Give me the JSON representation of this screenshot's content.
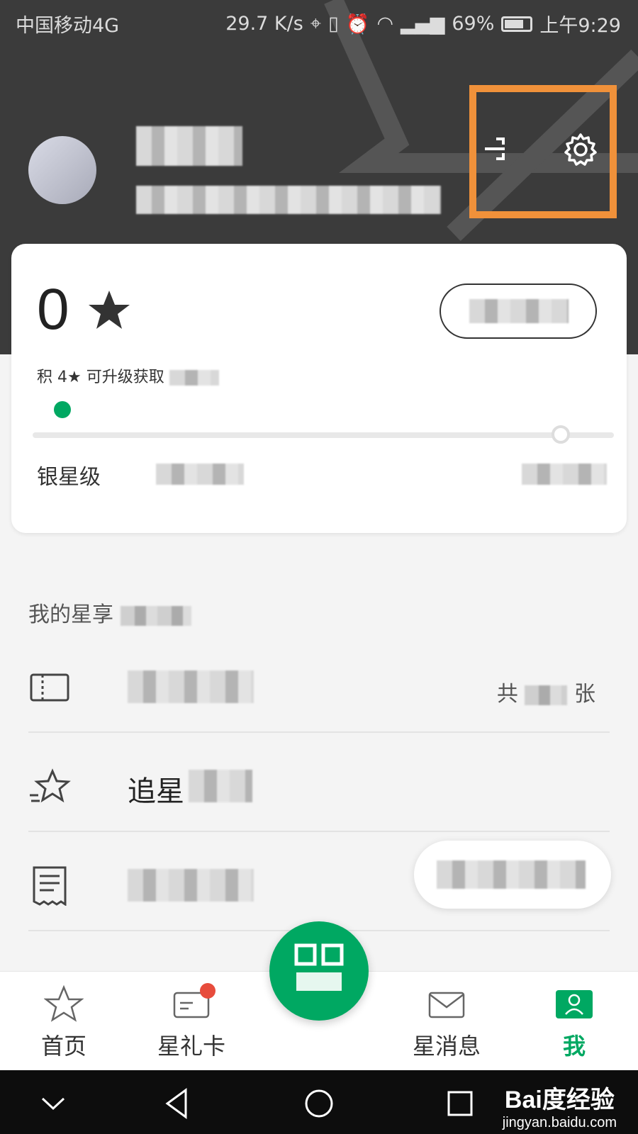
{
  "status_bar": {
    "carrier": "中国移动4G",
    "speed": "29.7 K/s",
    "battery": "69%",
    "time": "上午9:29"
  },
  "profile": {
    "name": "",
    "level_info": ""
  },
  "stars_card": {
    "count": "0",
    "upgrade_prefix": "积 4★ 可升级获取",
    "current_level": "银星级"
  },
  "section": {
    "title_prefix": "我的星享"
  },
  "list": [
    {
      "icon": "coupon-icon",
      "label": "",
      "right_prefix": "共",
      "right_suffix": "张"
    },
    {
      "icon": "star-chase-icon",
      "label": "追星"
    },
    {
      "icon": "receipt-icon",
      "label": ""
    }
  ],
  "float_button": {
    "label": ""
  },
  "tabs": [
    {
      "icon": "star-outline-icon",
      "label": "首页"
    },
    {
      "icon": "gift-card-icon",
      "label": "星礼卡"
    },
    {
      "icon": "envelope-icon",
      "label": "星消息"
    },
    {
      "icon": "person-icon",
      "label": "我"
    }
  ],
  "watermark": {
    "brand": "Bai度经验",
    "domain": "jingyan.baidu.com"
  },
  "colors": {
    "accent_green": "#00a862",
    "highlight_orange": "#f0913a",
    "header_bg": "#3b3b3b"
  }
}
